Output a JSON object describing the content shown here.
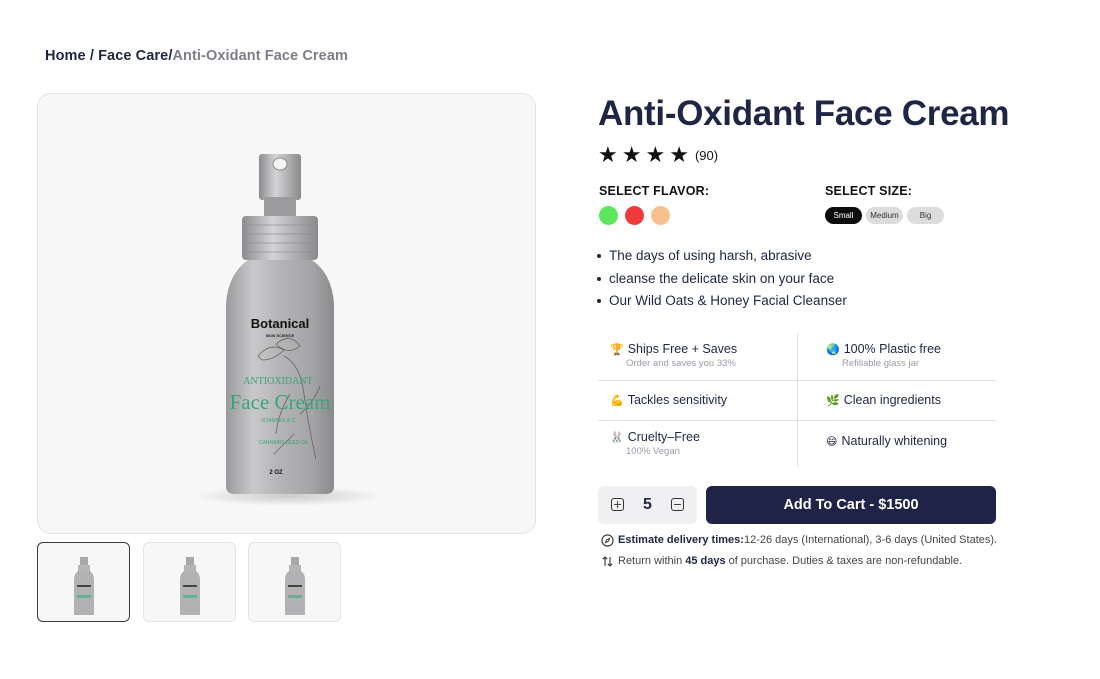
{
  "breadcrumb": {
    "home": "Home",
    "category": "Face Care",
    "current": "Anti-Oxidant Face Cream",
    "separator": " / ",
    "separator2": "/"
  },
  "product": {
    "title": "Anti-Oxidant Face Cream",
    "rating": 4,
    "review_count": "(90)",
    "image": {
      "brand": "Botanical",
      "brand_sub": "SKIN SCIENCE",
      "label_line1": "ANTIOXIDANT",
      "label_line2": "Face Cream",
      "label_line3": "VITAMIN E & C",
      "label_line4": "CANNABIS SEED OIL",
      "volume": "2 OZ"
    }
  },
  "options": {
    "flavor_label": "SELECT FLAVOR:",
    "flavors": [
      {
        "name": "green",
        "color": "#5ce65c"
      },
      {
        "name": "red",
        "color": "#f03a3a"
      },
      {
        "name": "peach",
        "color": "#f8c08f"
      }
    ],
    "size_label": "SELECT SIZE:",
    "sizes": [
      "Small",
      "Medium",
      "Big"
    ],
    "selected_size": "Small"
  },
  "bullets": [
    "The days of using harsh, abrasive",
    "cleanse the delicate skin on your face",
    "Our Wild Oats & Honey Facial Cleanser"
  ],
  "features": [
    {
      "icon": "trophy-icon",
      "emoji": "🏆",
      "title": "Ships Free + Saves",
      "subtitle": "Order and saves you 33%"
    },
    {
      "icon": "globe-icon",
      "emoji": "🌏",
      "title": "100% Plastic free",
      "subtitle": "Refillable glass jar"
    },
    {
      "icon": "flexed-bicep-icon",
      "emoji": "💪",
      "title": "Tackles sensitivity",
      "subtitle": ""
    },
    {
      "icon": "herb-icon",
      "emoji": "🌿",
      "title": "Clean ingredients",
      "subtitle": ""
    },
    {
      "icon": "rabbit-icon",
      "emoji": "🐰",
      "title": "Cruelty–Free",
      "subtitle": "100% Vegan"
    },
    {
      "icon": "smiling-face-icon",
      "emoji": "😄",
      "title": "Naturally whitening",
      "subtitle": ""
    }
  ],
  "cart": {
    "quantity": "5",
    "add_label": "Add To Cart - $1500"
  },
  "delivery": {
    "label": "Estimate delivery times:",
    "text": " 12-26 days (International), 3-6 days (United States)."
  },
  "returns": {
    "prefix": "Return within ",
    "days": "45 days",
    "suffix": " of purchase. Duties & taxes are non-refundable."
  },
  "colors": {
    "navy": "#1e2347",
    "text": "#1f2544",
    "muted": "#7d7f87",
    "bottle_label_green": "#3aa37a"
  }
}
